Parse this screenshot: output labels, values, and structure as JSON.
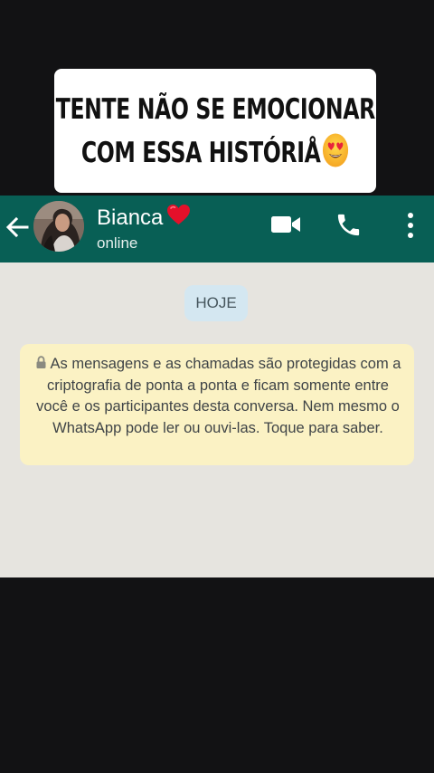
{
  "caption": {
    "line1": "TENTE NÃO SE EMOCIONAR",
    "line2": "COM ESSA HISTÓRIÅ",
    "emoji": "heart-eyes-emoji-icon"
  },
  "header": {
    "contact_name": "Bianca",
    "name_emoji": "red-heart-icon",
    "status": "online",
    "icons": [
      "back-arrow-icon",
      "avatar",
      "video-call-icon",
      "phone-icon",
      "more-vert-icon"
    ]
  },
  "chat": {
    "date_chip": "HOJE",
    "encryption_notice": "As mensagens e as chamadas são protegidas com a criptografia de ponta a ponta e ficam somente entre você e os participantes desta conversa. Nem mesmo o WhatsApp pode ler ou ouvi-las. Toque para saber.",
    "notice_icon": "lock-icon"
  },
  "colors": {
    "app_bar": "#085f55",
    "chat_background": "#e6e4df",
    "notice_background": "#fbf2c4",
    "date_chip_background": "#d4e7f1",
    "page_background": "#121214"
  }
}
